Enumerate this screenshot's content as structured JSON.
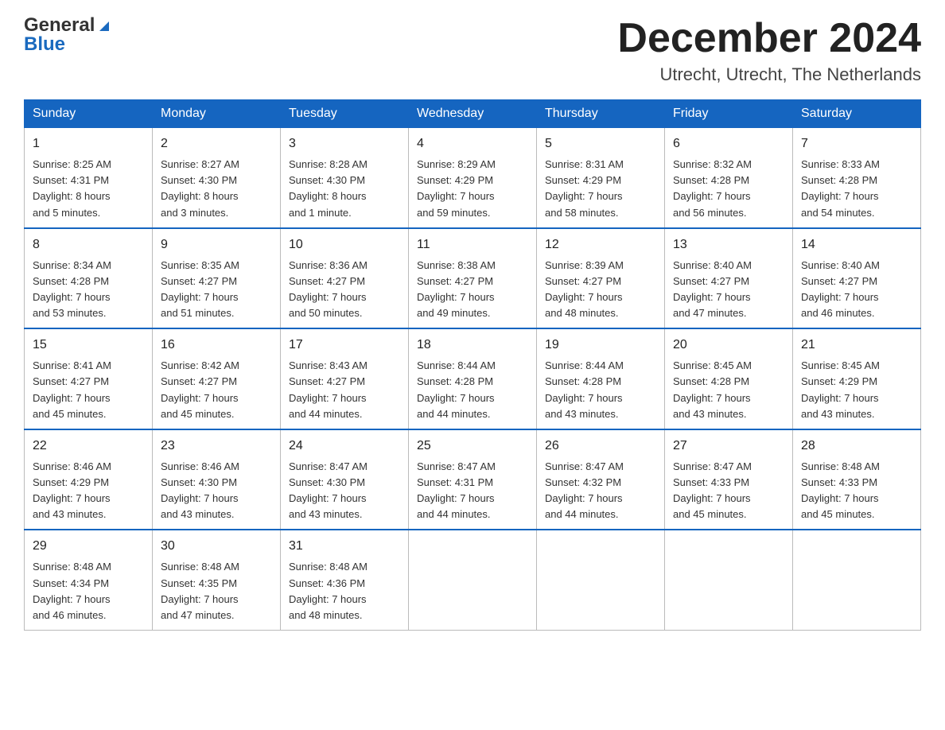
{
  "header": {
    "logo_general": "General",
    "logo_blue": "Blue",
    "main_title": "December 2024",
    "subtitle": "Utrecht, Utrecht, The Netherlands"
  },
  "calendar": {
    "headers": [
      "Sunday",
      "Monday",
      "Tuesday",
      "Wednesday",
      "Thursday",
      "Friday",
      "Saturday"
    ],
    "rows": [
      [
        {
          "day": "1",
          "info": "Sunrise: 8:25 AM\nSunset: 4:31 PM\nDaylight: 8 hours\nand 5 minutes."
        },
        {
          "day": "2",
          "info": "Sunrise: 8:27 AM\nSunset: 4:30 PM\nDaylight: 8 hours\nand 3 minutes."
        },
        {
          "day": "3",
          "info": "Sunrise: 8:28 AM\nSunset: 4:30 PM\nDaylight: 8 hours\nand 1 minute."
        },
        {
          "day": "4",
          "info": "Sunrise: 8:29 AM\nSunset: 4:29 PM\nDaylight: 7 hours\nand 59 minutes."
        },
        {
          "day": "5",
          "info": "Sunrise: 8:31 AM\nSunset: 4:29 PM\nDaylight: 7 hours\nand 58 minutes."
        },
        {
          "day": "6",
          "info": "Sunrise: 8:32 AM\nSunset: 4:28 PM\nDaylight: 7 hours\nand 56 minutes."
        },
        {
          "day": "7",
          "info": "Sunrise: 8:33 AM\nSunset: 4:28 PM\nDaylight: 7 hours\nand 54 minutes."
        }
      ],
      [
        {
          "day": "8",
          "info": "Sunrise: 8:34 AM\nSunset: 4:28 PM\nDaylight: 7 hours\nand 53 minutes."
        },
        {
          "day": "9",
          "info": "Sunrise: 8:35 AM\nSunset: 4:27 PM\nDaylight: 7 hours\nand 51 minutes."
        },
        {
          "day": "10",
          "info": "Sunrise: 8:36 AM\nSunset: 4:27 PM\nDaylight: 7 hours\nand 50 minutes."
        },
        {
          "day": "11",
          "info": "Sunrise: 8:38 AM\nSunset: 4:27 PM\nDaylight: 7 hours\nand 49 minutes."
        },
        {
          "day": "12",
          "info": "Sunrise: 8:39 AM\nSunset: 4:27 PM\nDaylight: 7 hours\nand 48 minutes."
        },
        {
          "day": "13",
          "info": "Sunrise: 8:40 AM\nSunset: 4:27 PM\nDaylight: 7 hours\nand 47 minutes."
        },
        {
          "day": "14",
          "info": "Sunrise: 8:40 AM\nSunset: 4:27 PM\nDaylight: 7 hours\nand 46 minutes."
        }
      ],
      [
        {
          "day": "15",
          "info": "Sunrise: 8:41 AM\nSunset: 4:27 PM\nDaylight: 7 hours\nand 45 minutes."
        },
        {
          "day": "16",
          "info": "Sunrise: 8:42 AM\nSunset: 4:27 PM\nDaylight: 7 hours\nand 45 minutes."
        },
        {
          "day": "17",
          "info": "Sunrise: 8:43 AM\nSunset: 4:27 PM\nDaylight: 7 hours\nand 44 minutes."
        },
        {
          "day": "18",
          "info": "Sunrise: 8:44 AM\nSunset: 4:28 PM\nDaylight: 7 hours\nand 44 minutes."
        },
        {
          "day": "19",
          "info": "Sunrise: 8:44 AM\nSunset: 4:28 PM\nDaylight: 7 hours\nand 43 minutes."
        },
        {
          "day": "20",
          "info": "Sunrise: 8:45 AM\nSunset: 4:28 PM\nDaylight: 7 hours\nand 43 minutes."
        },
        {
          "day": "21",
          "info": "Sunrise: 8:45 AM\nSunset: 4:29 PM\nDaylight: 7 hours\nand 43 minutes."
        }
      ],
      [
        {
          "day": "22",
          "info": "Sunrise: 8:46 AM\nSunset: 4:29 PM\nDaylight: 7 hours\nand 43 minutes."
        },
        {
          "day": "23",
          "info": "Sunrise: 8:46 AM\nSunset: 4:30 PM\nDaylight: 7 hours\nand 43 minutes."
        },
        {
          "day": "24",
          "info": "Sunrise: 8:47 AM\nSunset: 4:30 PM\nDaylight: 7 hours\nand 43 minutes."
        },
        {
          "day": "25",
          "info": "Sunrise: 8:47 AM\nSunset: 4:31 PM\nDaylight: 7 hours\nand 44 minutes."
        },
        {
          "day": "26",
          "info": "Sunrise: 8:47 AM\nSunset: 4:32 PM\nDaylight: 7 hours\nand 44 minutes."
        },
        {
          "day": "27",
          "info": "Sunrise: 8:47 AM\nSunset: 4:33 PM\nDaylight: 7 hours\nand 45 minutes."
        },
        {
          "day": "28",
          "info": "Sunrise: 8:48 AM\nSunset: 4:33 PM\nDaylight: 7 hours\nand 45 minutes."
        }
      ],
      [
        {
          "day": "29",
          "info": "Sunrise: 8:48 AM\nSunset: 4:34 PM\nDaylight: 7 hours\nand 46 minutes."
        },
        {
          "day": "30",
          "info": "Sunrise: 8:48 AM\nSunset: 4:35 PM\nDaylight: 7 hours\nand 47 minutes."
        },
        {
          "day": "31",
          "info": "Sunrise: 8:48 AM\nSunset: 4:36 PM\nDaylight: 7 hours\nand 48 minutes."
        },
        {
          "day": "",
          "info": ""
        },
        {
          "day": "",
          "info": ""
        },
        {
          "day": "",
          "info": ""
        },
        {
          "day": "",
          "info": ""
        }
      ]
    ]
  }
}
